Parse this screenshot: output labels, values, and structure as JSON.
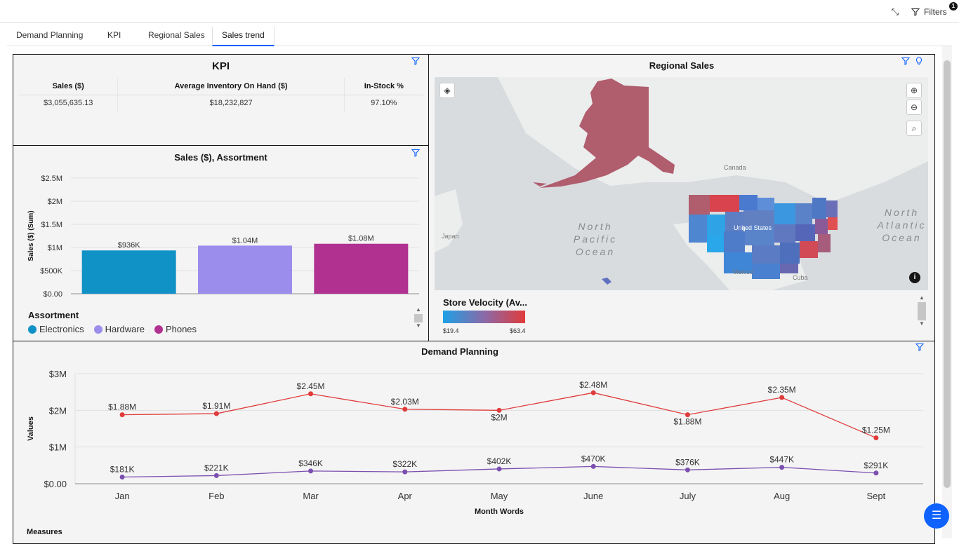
{
  "header": {
    "filters_label": "Filters",
    "filters_badge": "1",
    "collapse_icon": "collapse-icon",
    "filter_icon": "filter-icon"
  },
  "tabs": [
    {
      "label": "Demand Planning",
      "active": false
    },
    {
      "label": "KPI",
      "active": false
    },
    {
      "label": "Regional Sales",
      "active": false
    },
    {
      "label": "Sales trend",
      "active": true
    }
  ],
  "kpi": {
    "title": "KPI",
    "columns": [
      "Sales ($)",
      "Average Inventory On Hand ($)",
      "In-Stock %"
    ],
    "values": [
      "$3,055,635.13",
      "$18,232,827",
      "97.10%"
    ]
  },
  "assortment": {
    "title": "Sales ($), Assortment",
    "legend_title": "Assortment",
    "legend": [
      {
        "label": "Electronics",
        "color": "#1192c7"
      },
      {
        "label": "Hardware",
        "color": "#9b8deb"
      },
      {
        "label": "Phones",
        "color": "#b0318f"
      }
    ],
    "chart_data": {
      "type": "bar",
      "categories": [
        "Electronics",
        "Hardware",
        "Phones"
      ],
      "values": [
        936000,
        1040000,
        1080000
      ],
      "data_labels": [
        "$936K",
        "$1.04M",
        "$1.08M"
      ],
      "ylabel": "Sales ($) (Sum)",
      "yticks": [
        "$0.00",
        "$500K",
        "$1M",
        "$1.5M",
        "$2M",
        "$2.5M"
      ],
      "ylim": [
        0,
        2500000
      ],
      "grid": true
    }
  },
  "regional": {
    "title": "Regional Sales",
    "legend_title": "Store Velocity (Av...",
    "legend_min": "$19.4",
    "legend_max": "$63.4",
    "labels": {
      "canada": "Canada",
      "us": "United States",
      "mexico": "Mexico",
      "cuba": "Cuba",
      "japan": "Japan",
      "north_pacific": "North Pacific Ocean",
      "north_atlantic": "North Atlantic Ocean"
    },
    "color_low": "#1ea0e6",
    "color_high": "#e03b3b"
  },
  "demand": {
    "title": "Demand Planning",
    "legend_title": "Measures",
    "chart_data": {
      "type": "line",
      "categories": [
        "Jan",
        "Feb",
        "Mar",
        "Apr",
        "May",
        "June",
        "July",
        "Aug",
        "Sept"
      ],
      "xlabel": "Month Words",
      "ylabel": "Values",
      "yticks": [
        "$0.00",
        "$1M",
        "$2M",
        "$3M"
      ],
      "ylim": [
        0,
        3000000
      ],
      "series": [
        {
          "color": "#e03b3b",
          "values": [
            1880000,
            1910000,
            2450000,
            2030000,
            2000000,
            2480000,
            1880000,
            2350000,
            1250000
          ],
          "labels": [
            "$1.88M",
            "$1.91M",
            "$2.45M",
            "$2.03M",
            "$2M",
            "$2.48M",
            "$1.88M",
            "$2.35M",
            "$1.25M"
          ]
        },
        {
          "color": "#7b4fb0",
          "values": [
            181000,
            221000,
            346000,
            322000,
            402000,
            470000,
            376000,
            447000,
            291000
          ],
          "labels": [
            "$181K",
            "$221K",
            "$346K",
            "$322K",
            "$402K",
            "$470K",
            "$376K",
            "$447K",
            "$291K"
          ]
        }
      ]
    }
  }
}
